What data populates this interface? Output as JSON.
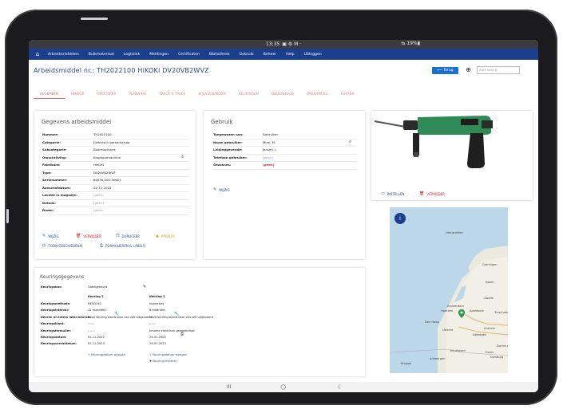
{
  "statusbar": {
    "time": "13:35",
    "icons": "▣ ⚙ M ·",
    "battery": "⇆ 19%▮"
  },
  "nav": {
    "home_icon": "home-icon",
    "items": [
      "Arbeidsmiddelen",
      "Bulkmateriaal",
      "Logistiek",
      "Meldingen",
      "Certificaten",
      "Bibliotheek",
      "Gebruik",
      "Beheer",
      "Help",
      "Uitloggen"
    ]
  },
  "header": {
    "title": "Arbeidsmiddel nr.: TH2022100 HiKOKI DV20VB2WVZ",
    "back_label": "⟵ Terug",
    "search_placeholder": "Zoek item #"
  },
  "tabs": [
    "ALGEMEEN",
    "INKOOP",
    "GEBRUIKER",
    "PLANNING",
    "TRACK & TRACE",
    "BIJLAGEN/MEDIA",
    "KEURINGEN",
    "ONDERHOUD",
    "UREN/KM/KG",
    "KOSTEN"
  ],
  "gegevens": {
    "title": "Gegevens arbeidsmiddel",
    "rows": [
      {
        "k": "Nummer:",
        "v": "TH2022100"
      },
      {
        "k": "Categorie:",
        "v": "Elektrisch gereedschap"
      },
      {
        "k": "Subcategorie:",
        "v": "Boormachines"
      },
      {
        "k": "Omschrijving:",
        "v": "Klopboormachine"
      },
      {
        "k": "Fabrikant:",
        "v": "HiKOKI"
      },
      {
        "k": "Type:",
        "v": "DV20VB2WVZ"
      },
      {
        "k": "Serienummer:",
        "v": "60230-501-30021"
      },
      {
        "k": "Aanschafdatum:",
        "v": "02-11-2022"
      },
      {
        "k": "Locatie in magazijn:",
        "v": "(geen)"
      },
      {
        "k": "Details:",
        "v": "(geen)"
      },
      {
        "k": "Dnoer:",
        "v": "(geen)"
      }
    ],
    "actions": {
      "wijzig": "WIJZIG",
      "verwijder": "VERWIJDER",
      "dupliceer": "DUPLICEER",
      "afkeuren": "AFKEURI",
      "geschiedenis": "TOON GESCHIEDENIS",
      "formulieren": "FORMULIEREN & LABELS"
    }
  },
  "gebruik": {
    "title": "Gebruik",
    "rows": [
      {
        "k": "Toegewezen aan:",
        "v": "Gebruiker"
      },
      {
        "k": "Naam gebruiker:",
        "v": "Mink, M."
      },
      {
        "k": "Leidinggevende:",
        "v": "Jansen, J."
      },
      {
        "k": "Telefoon gebruiker:",
        "v": "(geen)"
      },
      {
        "k": "Gezosnes:",
        "v": "(geen)"
      }
    ],
    "wijzig": "WIJZIG"
  },
  "foto": {
    "instellen": "INSTELLEN",
    "verwijder": "VERWIJDER"
  },
  "keuringen": {
    "title": "Keuringsgegevens",
    "keuringsbox_label": "Keuringsbox:",
    "keuringsbox_value": "Goedgekeurd",
    "col1": "Keuring 1",
    "col2": "Keuring 2",
    "rows": [
      {
        "k": "Keuringsmethode:",
        "v1": "NEN3140",
        "v2": "Inspecties"
      },
      {
        "k": "Keuringsinterval:",
        "v1": "12 maanden",
        "v2": "6 maanden"
      },
      {
        "k": "Keuren of extern laten keuren:",
        "v1": "Deze keuring wordt door ons zelf uitgevoerd",
        "v2": "Deze keuring wordt door ons zelf uitgevoerd"
      },
      {
        "k": "Keuringsklant:",
        "v1": "n.v.t.",
        "v2": "n.v.t."
      },
      {
        "k": "Keuringsformulier:",
        "v1": "n.v.t.",
        "v2": "Inname elektrisch gereedschap"
      },
      {
        "k": "Keuringsdatum:",
        "v1": "02-11-2022",
        "v2": "24-01-2022"
      },
      {
        "k": "Keuringsvervaldatum:",
        "v1": "02-11-2023",
        "v2": "24-07-2023"
      }
    ],
    "link1": "Keuringsdatum wijzigen",
    "link2": "Keuringsdatum wijzigen",
    "link3": "Keuring invoeren"
  },
  "map": {
    "labels": [
      "Groningen",
      "Leeuwarden",
      "Assen",
      "Zwolle",
      "Haarlem",
      "Amsterdam",
      "Den Haag",
      "Utrecht",
      "Apeldoorn",
      "Enschede",
      "Nijmegen",
      "Arnhem",
      "Antwerpen",
      "Brugge",
      "Essen",
      "Dortmund",
      "Duisburg",
      "Eindhoven"
    ],
    "info_icon": "info-icon",
    "pin_icon": "map-pin-icon"
  },
  "bottom": {
    "recent": "III",
    "home": "◯",
    "back": "〈"
  },
  "colors": {
    "nav": "#1a3f8f",
    "accent": "#1a6fd0",
    "tab": "#e08a8a",
    "danger": "#d42424",
    "warning": "#e89a1a"
  }
}
